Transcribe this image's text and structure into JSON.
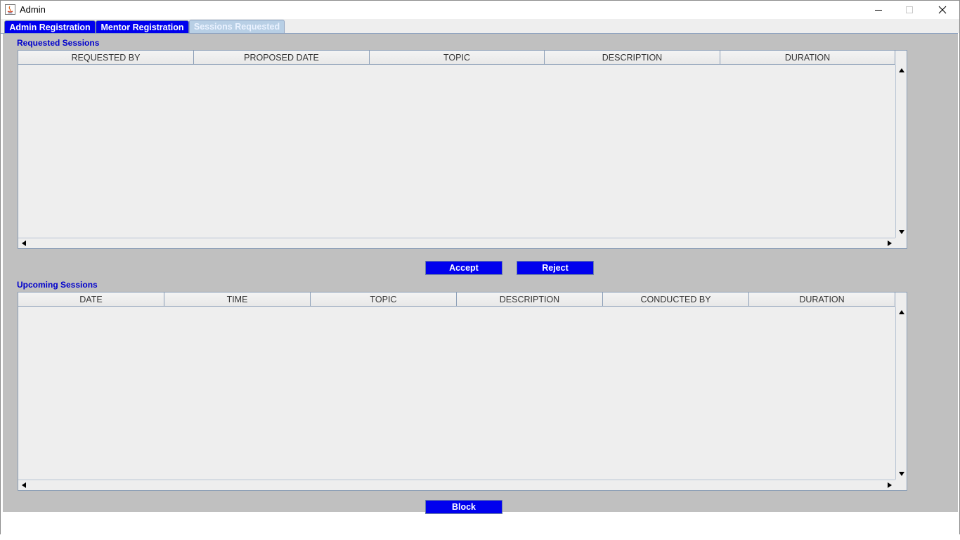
{
  "window": {
    "title": "Admin"
  },
  "tabs": [
    {
      "label": "Admin Registration",
      "selected": false
    },
    {
      "label": "Mentor Registration",
      "selected": false
    },
    {
      "label": "Sessions Requested",
      "selected": true
    }
  ],
  "requested": {
    "label": "Requested Sessions",
    "columns": [
      "REQUESTED BY",
      "PROPOSED DATE",
      "TOPIC",
      "DESCRIPTION",
      "DURATION"
    ],
    "rows": []
  },
  "actions": {
    "accept_label": "Accept",
    "reject_label": "Reject"
  },
  "upcoming": {
    "label": "Upcoming Sessions",
    "columns": [
      "DATE",
      "TIME",
      "TOPIC",
      "DESCRIPTION",
      "CONDUCTED BY",
      "DURATION"
    ],
    "rows": []
  },
  "block_label": "Block",
  "colors": {
    "button_bg": "#0000ee",
    "panel_bg": "#c0c0c0",
    "label_color": "#0000cc",
    "selected_tab": "#b8cfe5"
  }
}
